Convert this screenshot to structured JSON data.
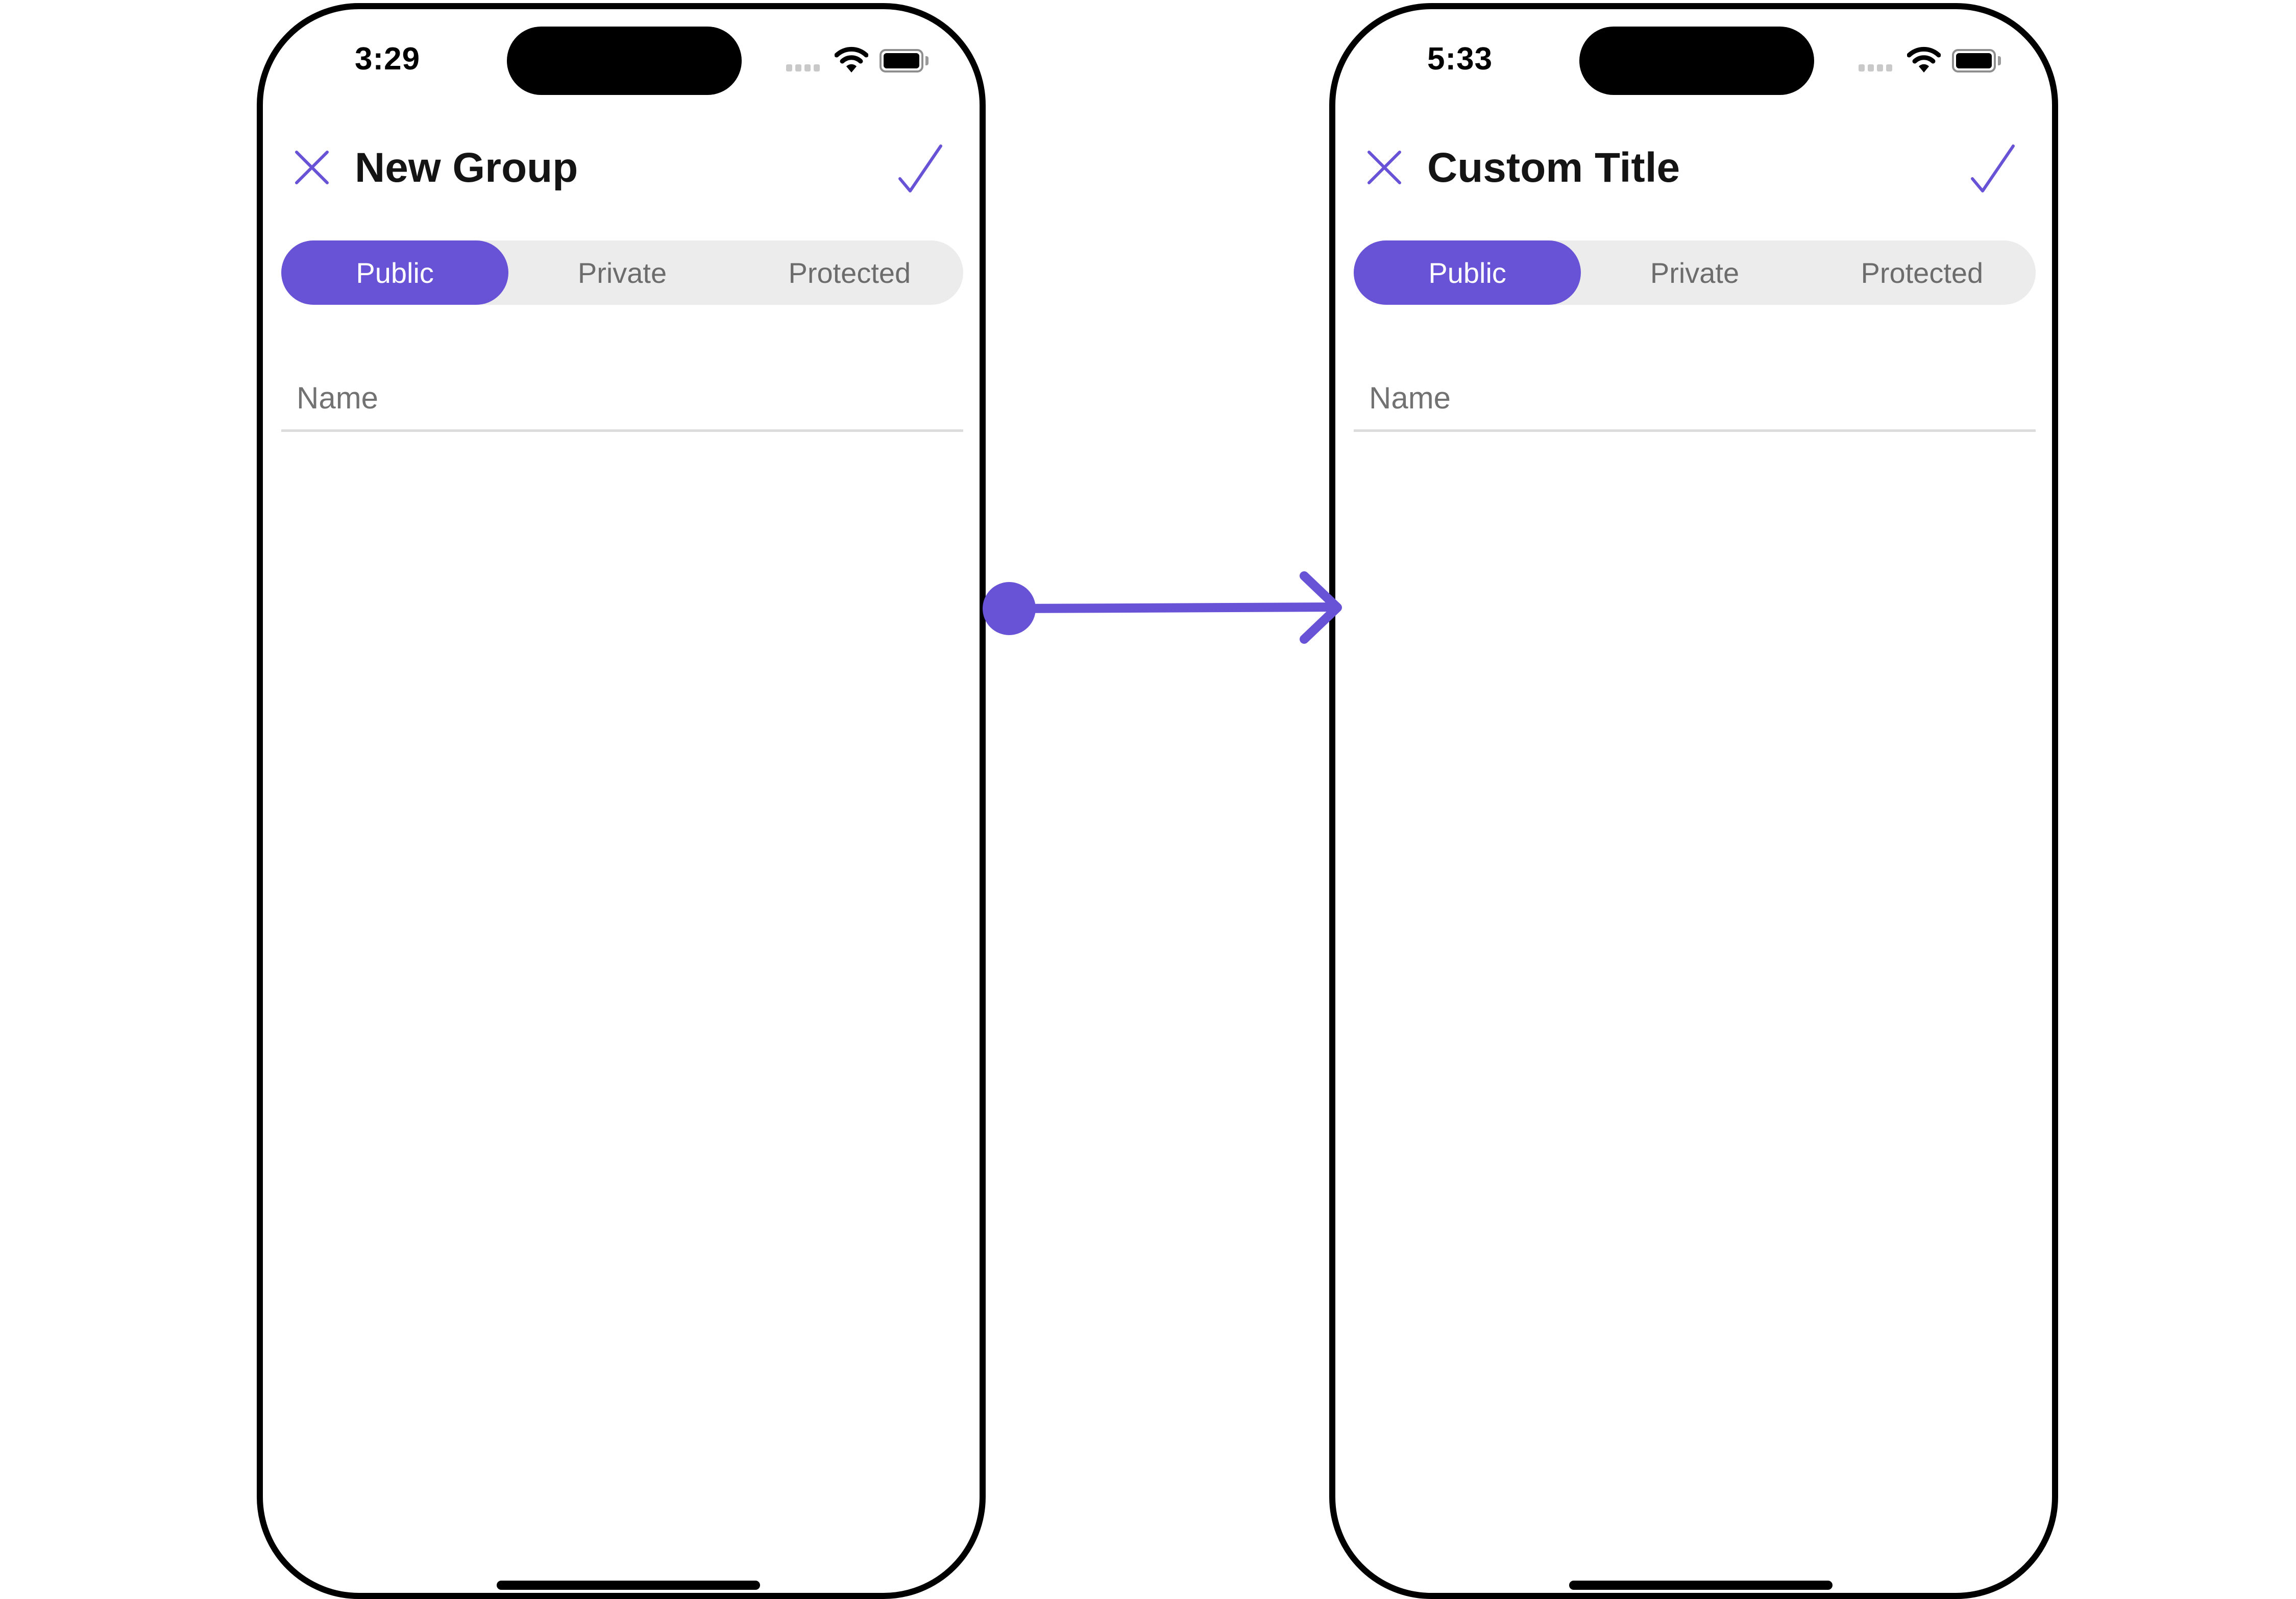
{
  "colors": {
    "accent": "#6852D6",
    "segment_bg": "#ececec",
    "divider": "#dcdcdc",
    "frame": "#000000"
  },
  "screens": [
    {
      "status": {
        "time": "3:29"
      },
      "header": {
        "title": "New Group",
        "close_icon": "close-icon",
        "confirm_icon": "checkmark-icon"
      },
      "segments": [
        {
          "label": "Public",
          "selected": true
        },
        {
          "label": "Private",
          "selected": false
        },
        {
          "label": "Protected",
          "selected": false
        }
      ],
      "name_field": {
        "placeholder": "Name",
        "value": ""
      }
    },
    {
      "status": {
        "time": "5:33"
      },
      "header": {
        "title": "Custom Title",
        "close_icon": "close-icon",
        "confirm_icon": "checkmark-icon"
      },
      "segments": [
        {
          "label": "Public",
          "selected": true
        },
        {
          "label": "Private",
          "selected": false
        },
        {
          "label": "Protected",
          "selected": false
        }
      ],
      "name_field": {
        "placeholder": "Name",
        "value": ""
      }
    }
  ],
  "connector": {
    "type": "arrow",
    "from": "screen-0",
    "to": "screen-1",
    "icon": "arrow-right-icon"
  }
}
